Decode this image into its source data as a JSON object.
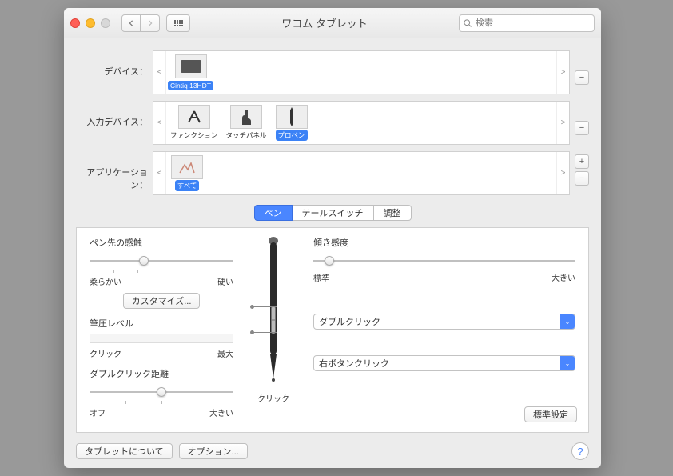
{
  "window": {
    "title": "ワコム タブレット"
  },
  "search": {
    "placeholder": "検索"
  },
  "rows": {
    "device": {
      "label": "デバイス：",
      "items": [
        "Cintiq 13HDT"
      ],
      "selected": 0
    },
    "input": {
      "label": "入力デバイス：",
      "items": [
        "ファンクション",
        "タッチパネル",
        "プロペン"
      ],
      "selected": 2
    },
    "app": {
      "label": "アプリケーション：",
      "items": [
        "すべて"
      ],
      "selected": 0
    }
  },
  "tabs": [
    "ペン",
    "テールスイッチ",
    "調整"
  ],
  "panel": {
    "tip": {
      "label": "ペン先の感触",
      "min": "柔らかい",
      "max": "硬い",
      "customize": "カスタマイズ..."
    },
    "pressure": {
      "label": "筆圧レベル",
      "min": "クリック",
      "max": "最大"
    },
    "dblclick": {
      "label": "ダブルクリック距離",
      "min": "オフ",
      "max": "大きい"
    },
    "tilt": {
      "label": "傾き感度",
      "min": "標準",
      "max": "大きい"
    },
    "penbtn1": "ダブルクリック",
    "penbtn2": "右ボタンクリック",
    "pentip": "クリック",
    "defaults": "標準設定"
  },
  "footer": {
    "about": "タブレットについて",
    "options": "オプション..."
  }
}
